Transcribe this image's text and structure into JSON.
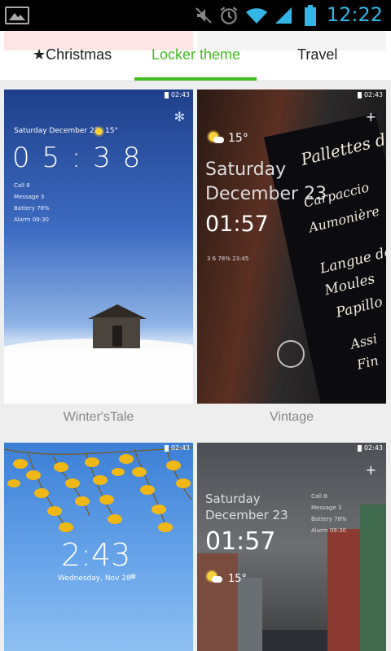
{
  "status_bar": {
    "time": "12:22",
    "icons": [
      "gallery-icon",
      "mute-icon",
      "alarm-icon",
      "wifi-icon",
      "signal-icon",
      "battery-icon"
    ],
    "accent": "#33b5e5"
  },
  "tabs": {
    "items": [
      {
        "label": "★Christmas"
      },
      {
        "label": "Locker theme"
      },
      {
        "label": "Travel"
      }
    ],
    "active_color": "#44bb22"
  },
  "themes": [
    {
      "caption": "Winter'sTale",
      "preview": {
        "status": "02:43",
        "date": "Saturday  December 23",
        "temp": "15°",
        "clock": "0 5 : 3 8",
        "info": [
          "Call 8",
          "Message 3",
          "Battery 78%",
          "Alarm 09:30"
        ]
      }
    },
    {
      "caption": "Vintage",
      "preview": {
        "status": "02:43",
        "temp": "15°",
        "day": "Saturday",
        "date": "December 23",
        "clock": "01:57",
        "info": "3    6    78%    23:45",
        "chalk": [
          "Pallettes de",
          "Carpaccio",
          "Aumonière",
          "Langue de",
          "Moules",
          "Papillo",
          "Assi",
          "Fin"
        ]
      }
    },
    {
      "caption": "",
      "preview": {
        "status": "02:43",
        "clock": "2:43",
        "date": "Wednesday, Nov 28"
      }
    },
    {
      "caption": "",
      "preview": {
        "status": "02:43",
        "day": "Saturday",
        "date": "December 23",
        "clock": "01:57",
        "temp": "15°",
        "info": [
          "Call 8",
          "Message 3",
          "Battery 78%",
          "Alarm 09:30"
        ]
      }
    }
  ]
}
